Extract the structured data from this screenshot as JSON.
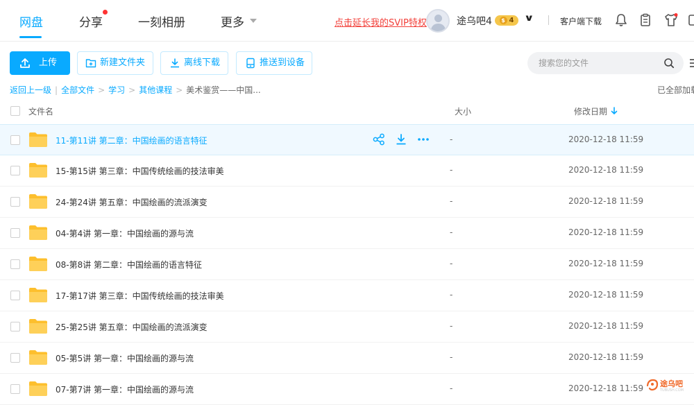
{
  "nav": {
    "items": [
      {
        "label": "网盘",
        "active": true
      },
      {
        "label": "分享",
        "has_dot": true
      },
      {
        "label": "一刻相册"
      },
      {
        "label": "更多",
        "has_caret": true
      }
    ],
    "svip_link": "点击延长我的SVIP特权",
    "username": "途乌吧4",
    "vip_level": "4",
    "vip_coin": "$",
    "client_download": "客户端下载",
    "accent_color": "#09aaff",
    "alert_color": "#f2403a"
  },
  "toolbar": {
    "upload": "上传",
    "new_folder": "新建文件夹",
    "offline_download": "离线下载",
    "push_to_device": "推送到设备",
    "search_placeholder": "搜索您的文件"
  },
  "breadcrumb": {
    "back": "返回上一级",
    "items": [
      "全部文件",
      "学习",
      "其他课程",
      "美术鉴赏——中国..."
    ],
    "loaded_status": "已全部加载"
  },
  "table": {
    "columns": {
      "name": "文件名",
      "size": "大小",
      "modified": "修改日期"
    },
    "rows": [
      {
        "name": "11-第11讲 第二章：中国绘画的语言特征",
        "size": "-",
        "date": "2020-12-18 11:59"
      },
      {
        "name": "15-第15讲 第三章：中国传统绘画的技法审美",
        "size": "-",
        "date": "2020-12-18 11:59"
      },
      {
        "name": "24-第24讲 第五章：中国绘画的流派演变",
        "size": "-",
        "date": "2020-12-18 11:59"
      },
      {
        "name": "04-第4讲 第一章：中国绘画的源与流",
        "size": "-",
        "date": "2020-12-18 11:59"
      },
      {
        "name": "08-第8讲 第二章：中国绘画的语言特征",
        "size": "-",
        "date": "2020-12-18 11:59"
      },
      {
        "name": "17-第17讲 第三章：中国传统绘画的技法审美",
        "size": "-",
        "date": "2020-12-18 11:59"
      },
      {
        "name": "25-第25讲 第五章：中国绘画的流派演变",
        "size": "-",
        "date": "2020-12-18 11:59"
      },
      {
        "name": "05-第5讲 第一章：中国绘画的源与流",
        "size": "-",
        "date": "2020-12-18 11:59"
      },
      {
        "name": "07-第7讲 第一章：中国绘画的源与流",
        "size": "-",
        "date": "2020-12-18 11:59"
      }
    ]
  },
  "watermark": {
    "text": "途乌吧",
    "subtext": "TUBUSH.COM"
  }
}
